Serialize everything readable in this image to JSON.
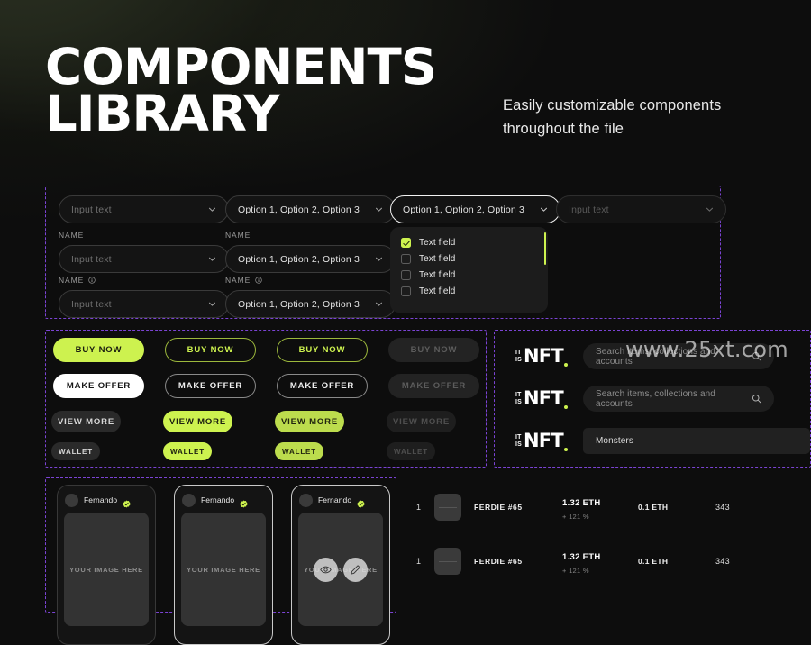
{
  "header": {
    "title_line1": "COMPONENTS",
    "title_line2": "LIBRARY",
    "subtitle_line1": "Easily customizable components",
    "subtitle_line2": "throughout the file"
  },
  "colors": {
    "accent_lime": "#cdf24f",
    "background": "#0d0d0d",
    "panel_outline": "#7b43d4",
    "surface": "#141414"
  },
  "watermark": "www.25xt.com",
  "forms": {
    "input_placeholder": "Input text",
    "select_value": "Option 1, Option 2, Option 3",
    "label": "NAME",
    "info_icon": "info-circle-icon",
    "chevron_icon": "chevron-down-icon",
    "dropdown": {
      "items": [
        {
          "label": "Text field",
          "checked": true
        },
        {
          "label": "Text field",
          "checked": false
        },
        {
          "label": "Text field",
          "checked": false
        },
        {
          "label": "Text field",
          "checked": false
        }
      ]
    }
  },
  "buttons": {
    "labels": {
      "buy_now": "BUY NOW",
      "make_offer": "MAKE OFFER",
      "view_more": "VIEW MORE",
      "wallet": "WALLET"
    },
    "states": [
      "default",
      "outline",
      "hover",
      "disabled"
    ]
  },
  "search": {
    "logo": {
      "top": "IT",
      "bottom": "IS",
      "mark": "NFT",
      "dot": "."
    },
    "placeholder": "Search items, collections and accounts",
    "filled_value": "Monsters",
    "search_icon": "magnifier-icon"
  },
  "cards": [
    {
      "username": "Fernando",
      "verified": true,
      "image_placeholder": "YOUR IMAGE HERE",
      "highlighted": false,
      "overlay": false
    },
    {
      "username": "Fernando",
      "verified": true,
      "image_placeholder": "YOUR IMAGE HERE",
      "highlighted": true,
      "overlay": false
    },
    {
      "username": "Fernando",
      "verified": true,
      "image_placeholder": "YOUR IMAGE HERE",
      "highlighted": true,
      "overlay": true
    }
  ],
  "card_overlay_icons": {
    "view": "eye-icon",
    "edit": "pencil-icon"
  },
  "table": {
    "rows": [
      {
        "rank": "1",
        "name": "FERDIE #65",
        "price": "1.32 ETH",
        "change": "+ 121 %",
        "floor": "0.1 ETH",
        "count": "343"
      },
      {
        "rank": "1",
        "name": "FERDIE #65",
        "price": "1.32 ETH",
        "change": "+ 121 %",
        "floor": "0.1 ETH",
        "count": "343"
      }
    ]
  }
}
